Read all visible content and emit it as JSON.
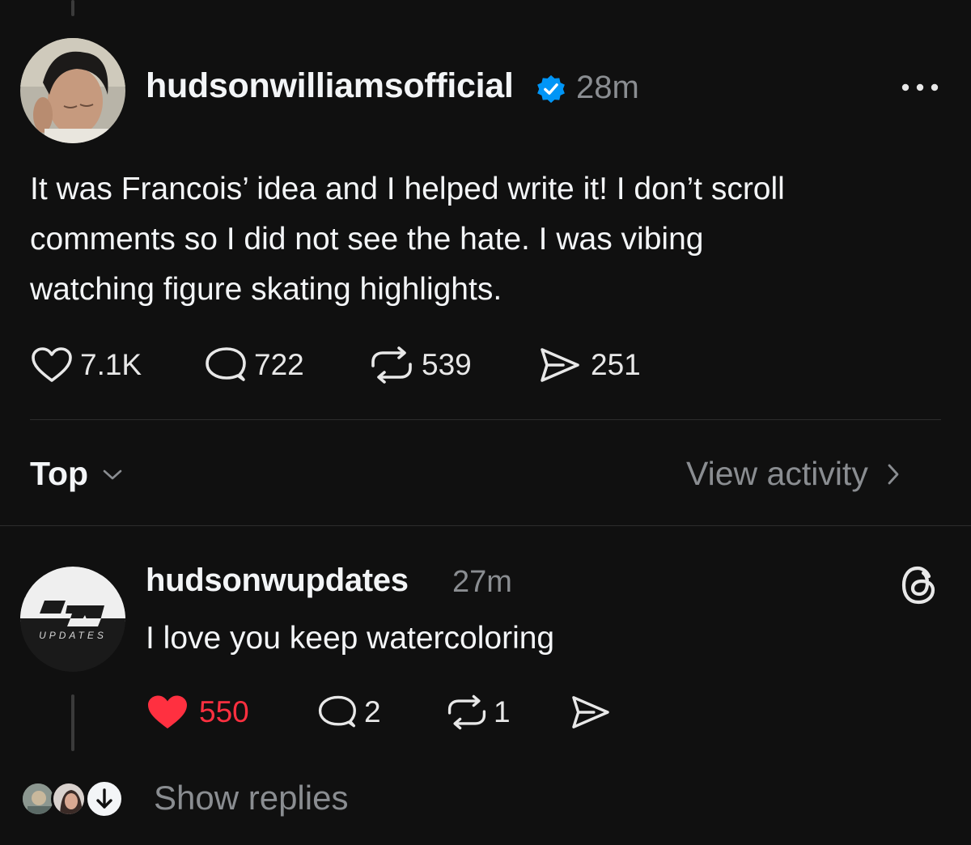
{
  "post": {
    "username": "hudsonwilliamsofficial",
    "time": "28m",
    "text": "It was Francois’ idea and I helped write it!  I don’t scroll comments so I did not see the hate. I was vibing watching figure skating highlights.",
    "text_lines": [
      "It was Francois’ idea and I helped write it!  I don’t scroll",
      "comments so I did not see the hate. I was vibing",
      "watching figure skating highlights."
    ],
    "likes": "7.1K",
    "comments": "722",
    "reposts": "539",
    "shares": "251"
  },
  "sort": {
    "label": "Top",
    "view_activity": "View activity"
  },
  "reply": {
    "username": "hudsonwupdates",
    "time": "27m",
    "text": "I love you keep watercoloring",
    "avatar_text": "UPDATES",
    "likes": "550",
    "comments": "2",
    "reposts": "1",
    "show_replies": "Show replies"
  },
  "colors": {
    "background": "#101010",
    "verified": "#0095f6",
    "liked": "#ff3040",
    "muted": "#8a8d91"
  }
}
